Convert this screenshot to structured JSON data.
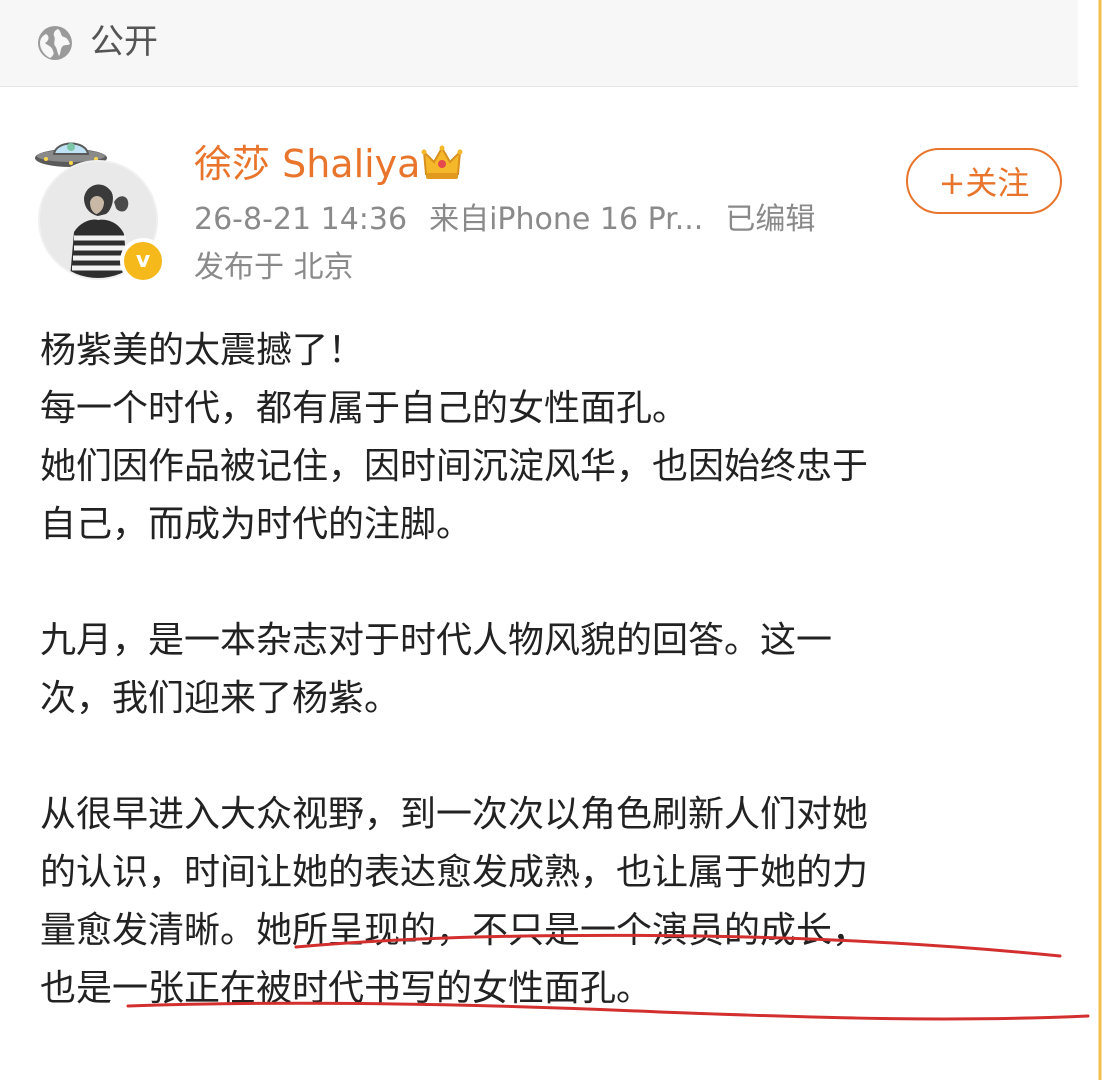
{
  "topbar": {
    "privacy_label": "公开",
    "icon": "globe-icon"
  },
  "post": {
    "username": "徐莎 Shaliya",
    "verified_icon": "v-badge-icon",
    "crown_icon": "crown-icon",
    "time": "26-8-21 14:36",
    "source": "来自iPhone 16 Pr...",
    "edited": "已编辑",
    "location": "发布于 北京",
    "follow_label": "+关注",
    "lines": [
      "杨紫美的太震撼了！",
      "每一个时代，都有属于自己的女性面孔。",
      "她们因作品被记住，因时间沉淀风华，也因始终忠于",
      "自己，而成为时代的注脚。",
      "",
      "九月，是一本杂志对于时代人物风貌的回答。这一",
      "次，我们迎来了杨紫。",
      "",
      "从很早进入大众视野，到一次次以角色刷新人们对她",
      "的认识，时间让她的表达愈发成熟，也让属于她的力",
      "量愈发清晰。她所呈现的，不只是一个演员的成长，",
      "也是一张正在被时代书写的女性面孔。"
    ]
  },
  "colors": {
    "accent": "#e8752b",
    "underline": "#d32f2f",
    "meta": "#8a8a8a"
  }
}
